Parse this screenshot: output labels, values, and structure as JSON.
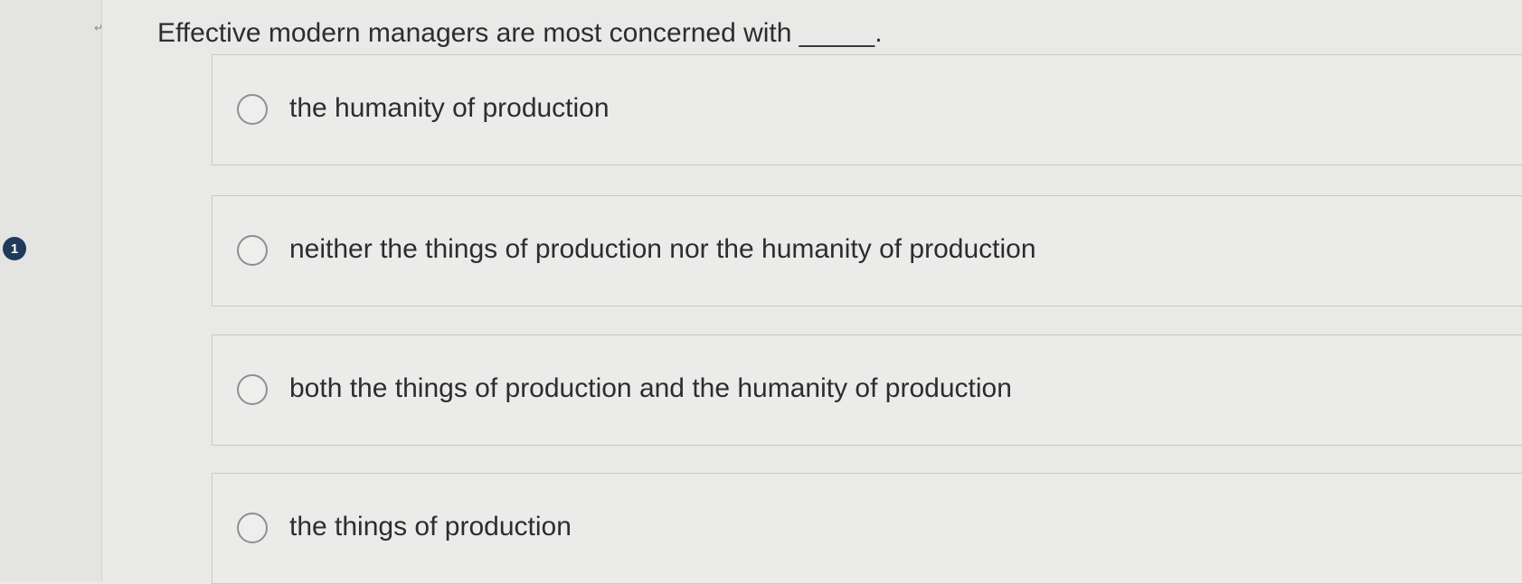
{
  "question": {
    "number": "1",
    "text": "Effective modern managers are most concerned with _____."
  },
  "gutter": {
    "mark": "↵"
  },
  "options": [
    {
      "label": "the humanity of production",
      "selected": false
    },
    {
      "label": "neither the things of production nor the humanity of production",
      "selected": false
    },
    {
      "label": "both the things of production and the humanity of production",
      "selected": false
    },
    {
      "label": "the things of production",
      "selected": false
    }
  ]
}
